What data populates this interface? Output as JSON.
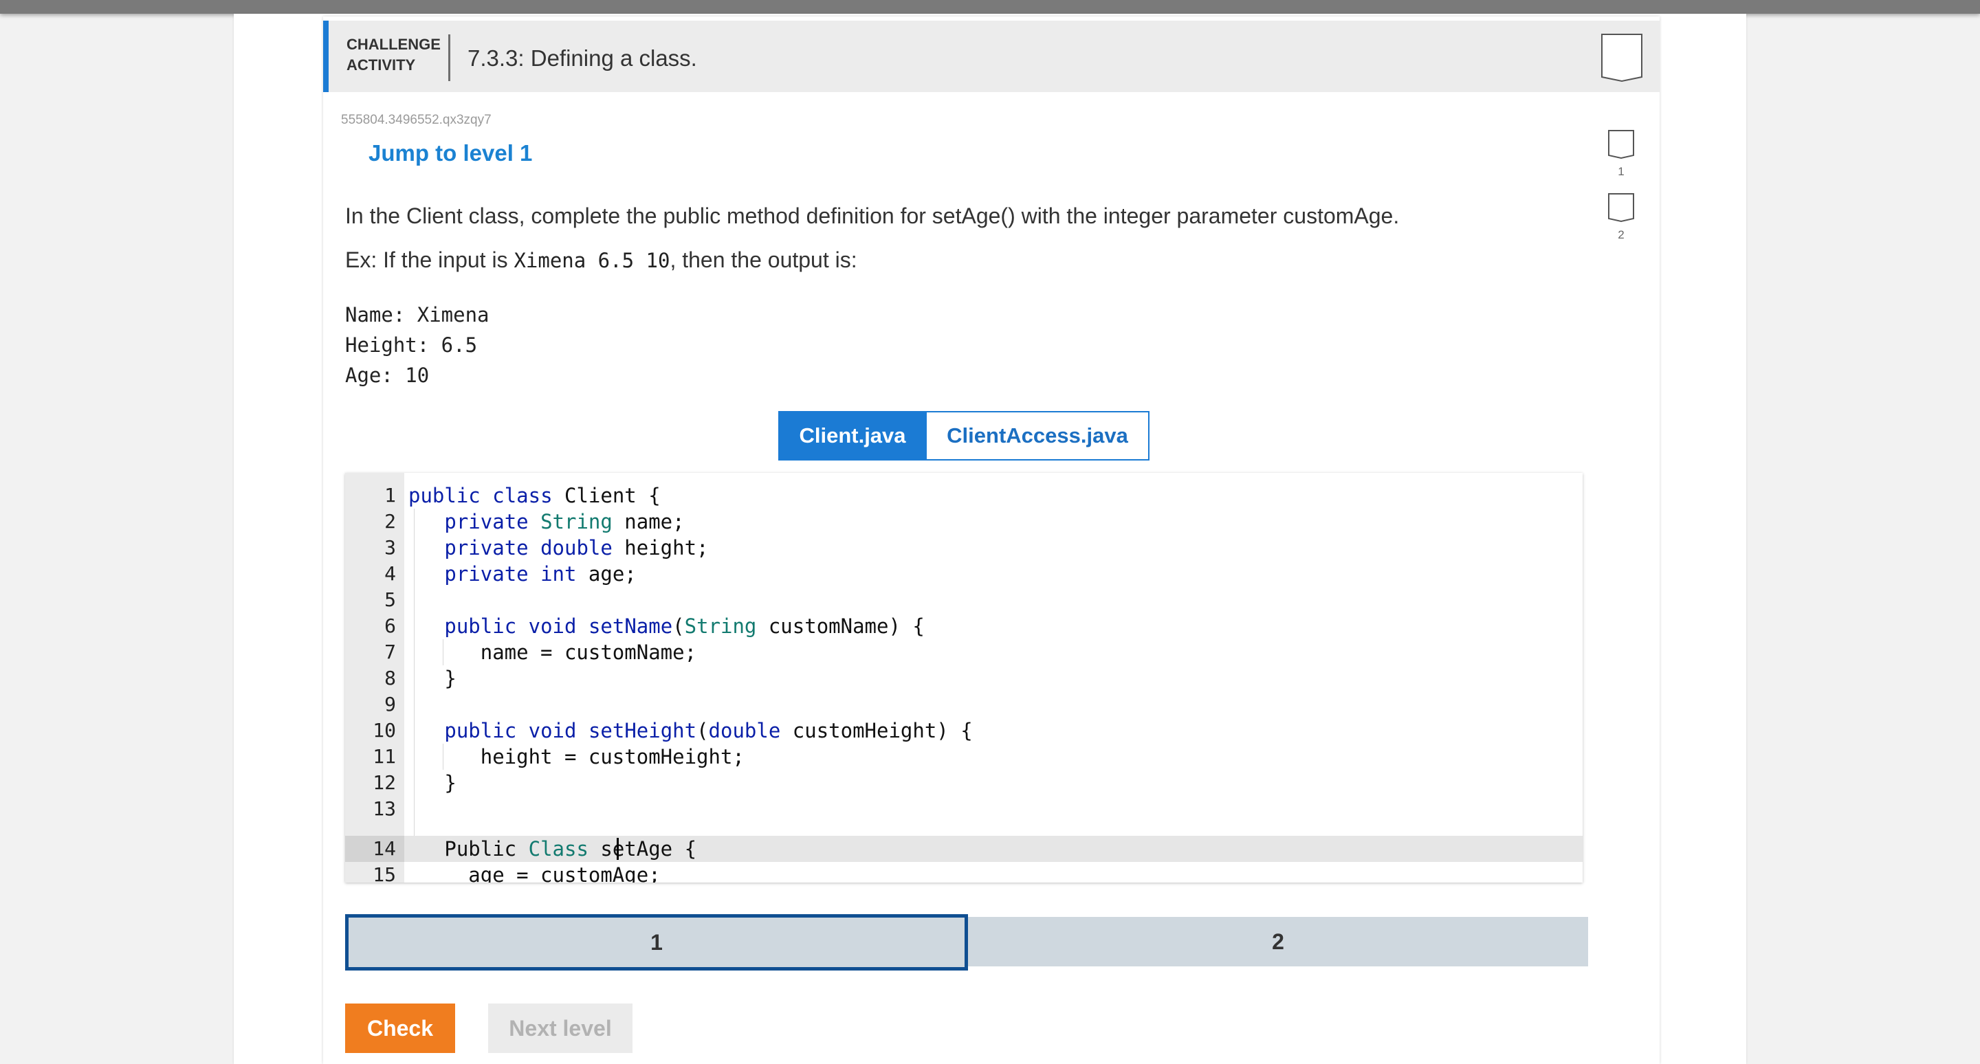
{
  "header": {
    "challenge_label_line1": "CHALLENGE",
    "challenge_label_line2": "ACTIVITY",
    "title": "7.3.3: Defining a class."
  },
  "activity_id": "555804.3496552.qx3zqy7",
  "jump_link": "Jump to level 1",
  "prompt": "In the Client class, complete the public method definition for setAge() with the integer parameter customAge.",
  "example": {
    "prefix": "Ex: If the input is ",
    "input": "Ximena 6.5 10",
    "suffix": ", then the output is:"
  },
  "output_lines": [
    "Name: Ximena",
    "Height: 6.5",
    "Age: 10"
  ],
  "tabs": [
    {
      "label": "Client.java",
      "active": true
    },
    {
      "label": "ClientAccess.java",
      "active": false
    }
  ],
  "code": {
    "line_numbers": [
      "1",
      "2",
      "3",
      "4",
      "5",
      "6",
      "7",
      "8",
      "9",
      "10",
      "11",
      "12",
      "13",
      "14",
      "15"
    ],
    "highlighted_line": "14"
  },
  "levels": [
    {
      "label": "1",
      "selected": true
    },
    {
      "label": "2",
      "selected": false
    }
  ],
  "buttons": {
    "check": "Check",
    "next_level": "Next level"
  },
  "level_indicators": [
    "1",
    "2"
  ],
  "colors": {
    "accent": "#1b7bd4",
    "check_button": "#f07d1f",
    "level_selected_border": "#104f92",
    "keyword": "#0a1fa8",
    "type": "#127a6f"
  }
}
